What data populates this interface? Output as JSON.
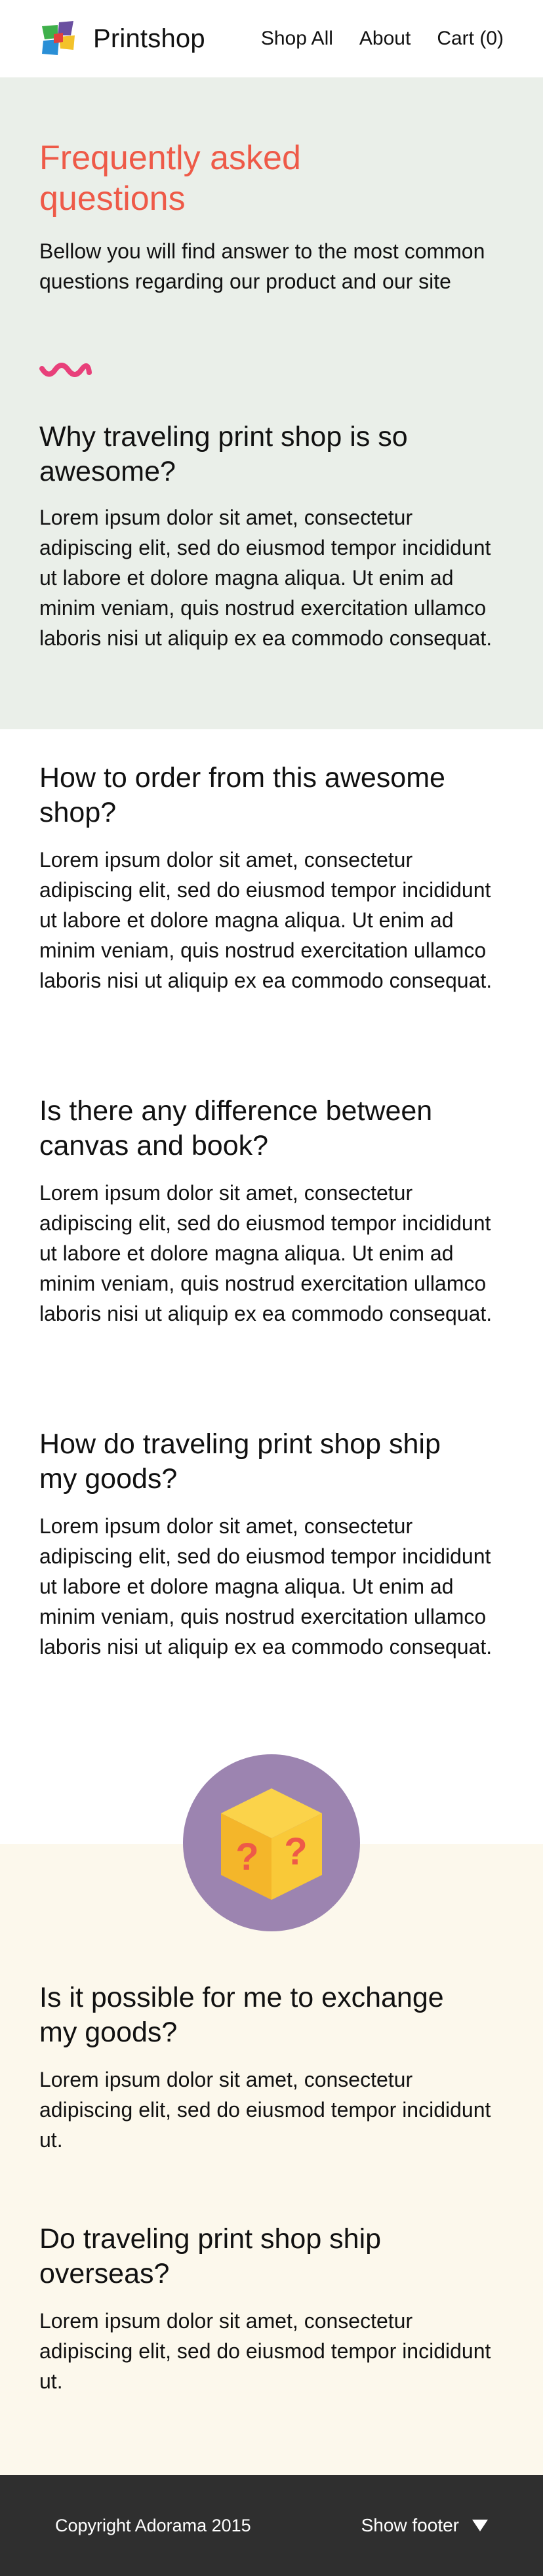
{
  "header": {
    "brand": "Printshop",
    "nav": [
      {
        "label": "Shop All"
      },
      {
        "label": "About"
      },
      {
        "label": "Cart (0)"
      }
    ]
  },
  "hero": {
    "title": "Frequently asked questions",
    "subtitle": "Bellow you will find answer to the most common questions regarding our product and our site"
  },
  "faq": [
    {
      "question": "Why traveling print shop is so awesome?",
      "answer": "Lorem ipsum dolor sit amet, consectetur adipiscing elit, sed do eiusmod tempor incididunt ut labore et dolore magna aliqua. Ut enim ad minim veniam, quis nostrud exercitation ullamco laboris nisi ut aliquip ex ea commodo consequat."
    },
    {
      "question": "How to order from this awesome shop?",
      "answer": "Lorem ipsum dolor sit amet, consectetur adipiscing elit, sed do eiusmod tempor incididunt ut labore et dolore magna aliqua. Ut enim ad minim veniam, quis nostrud exercitation ullamco laboris nisi ut aliquip ex ea commodo consequat."
    },
    {
      "question": "Is there any difference between canvas and book?",
      "answer": "Lorem ipsum dolor sit amet, consectetur adipiscing elit, sed do eiusmod tempor incididunt ut labore et dolore magna aliqua. Ut enim ad minim veniam, quis nostrud exercitation ullamco laboris nisi ut aliquip ex ea commodo consequat."
    },
    {
      "question": "How do traveling print shop ship my goods?",
      "answer": "Lorem ipsum dolor sit amet, consectetur adipiscing elit, sed do eiusmod tempor incididunt ut labore et dolore magna aliqua. Ut enim ad minim veniam, quis nostrud exercitation ullamco laboris nisi ut aliquip ex ea commodo consequat."
    },
    {
      "question": "Is it possible for me to exchange my goods?",
      "answer": "Lorem ipsum dolor sit amet, consectetur adipiscing elit, sed do eiusmod tempor incididunt ut."
    },
    {
      "question": "Do traveling print shop ship overseas?",
      "answer": "Lorem ipsum dolor sit amet, consectetur adipiscing elit, sed do eiusmod tempor incididunt ut."
    }
  ],
  "illustration": {
    "icon": "mystery-box-icon",
    "mark": "?"
  },
  "footer": {
    "copyright": "Copyright Adorama 2015",
    "show_footer": "Show footer"
  },
  "colors": {
    "accent": "#ee5a48",
    "squiggle": "#e8407a",
    "hero_bg": "#eaefe9",
    "cream_bg": "#fcf8ec",
    "footer_bg": "#2f2f2f",
    "circle": "#9c84b0",
    "box": "#f8c52a"
  }
}
